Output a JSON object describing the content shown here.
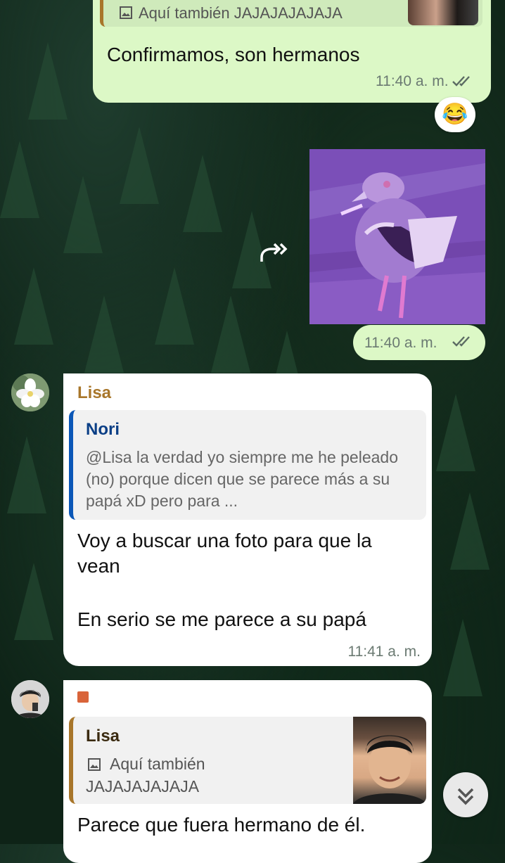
{
  "messages": {
    "m1": {
      "quote_text": "Aquí también JAJAJAJAJAJA",
      "text": "Confirmamos, son hermanos",
      "time": "11:40 a. m.",
      "reaction": "😂"
    },
    "m2": {
      "time": "11:40 a. m."
    },
    "m3": {
      "sender": "Lisa",
      "quote_author": "Nori",
      "quote_text": "@Lisa la verdad yo siempre me he peleado (no) porque dicen que se parece más a su papá xD pero para ...",
      "text_line1": "Voy a buscar una foto para que la",
      "text_line2": "vean",
      "text_line3": "En serio se me parece a su papá",
      "time": "11:41 a. m."
    },
    "m4": {
      "quote_author": "Lisa",
      "quote_text_line1": "Aquí también",
      "quote_text_line2": "JAJAJAJAJAJA",
      "text": "Parece que fuera hermano de él."
    }
  },
  "colors": {
    "outgoing_bubble": "#dcf8c6",
    "incoming_bubble": "#ffffff",
    "sender_lisa": "#a8762a",
    "quote_nori": "#0b57b7",
    "quote_bar_lisa": "#a8762a",
    "read_ticks": "#5b6b63"
  },
  "icons": {
    "forward": "forward-arrow-icon",
    "scroll_down": "double-chevron-down-icon",
    "image": "image-icon"
  }
}
